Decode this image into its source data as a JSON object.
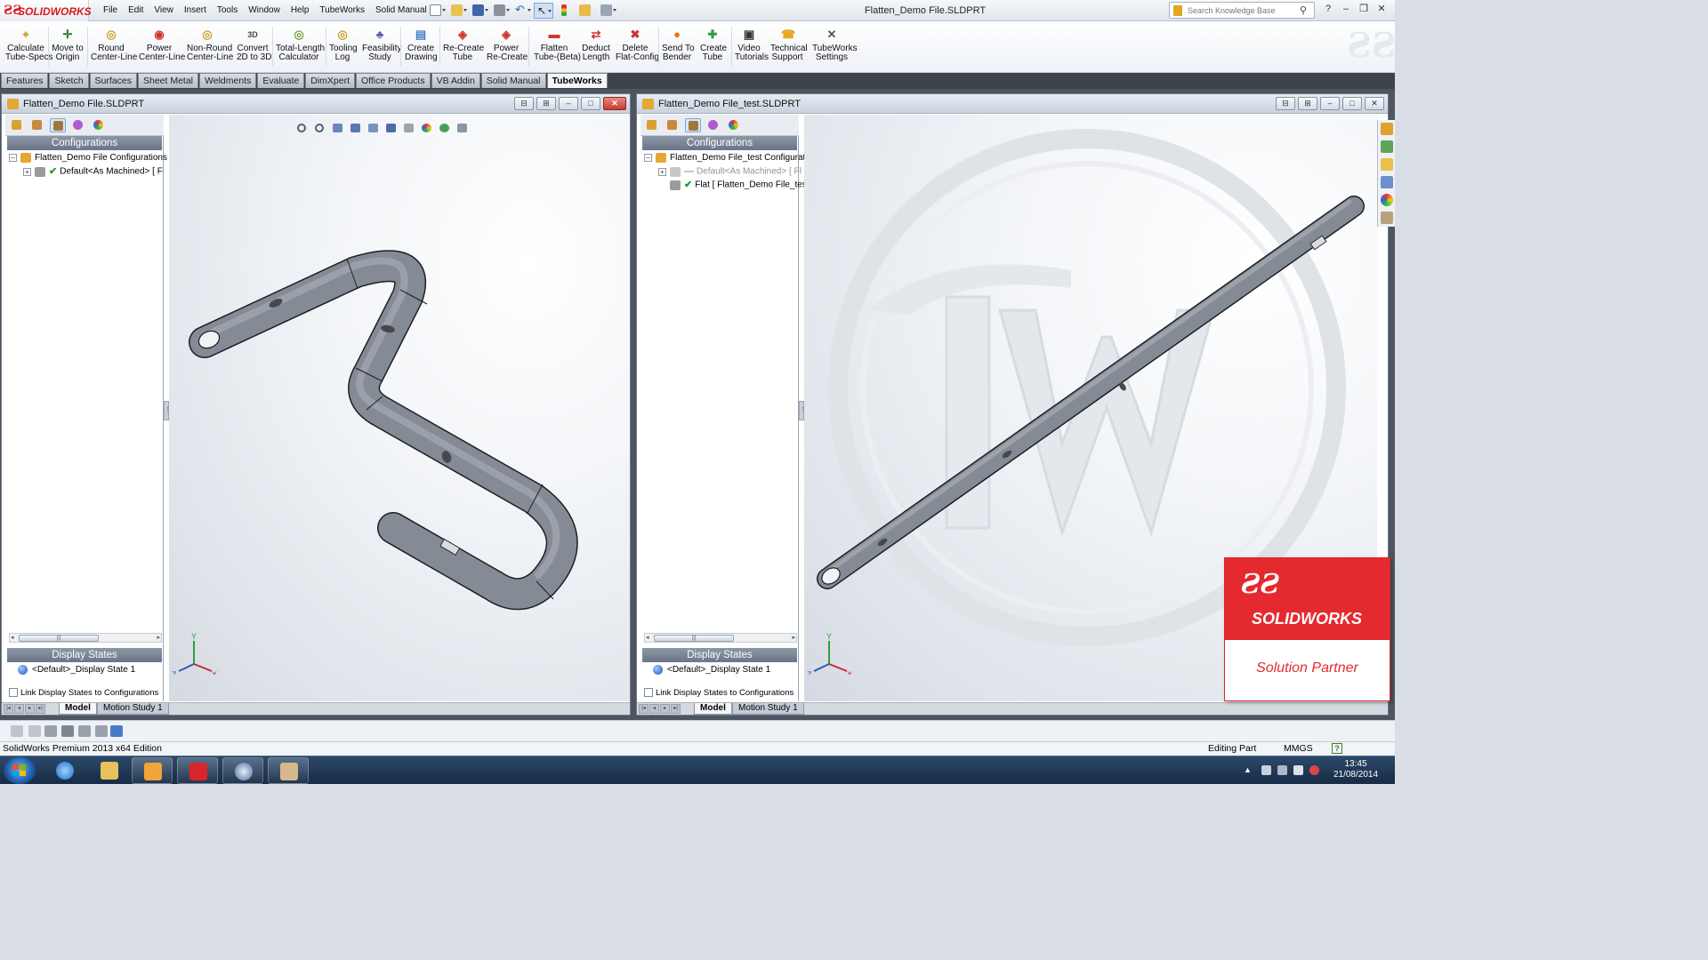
{
  "app": {
    "logo_text": "SOLIDWORKS",
    "document_title": "Flatten_Demo File.SLDPRT"
  },
  "menu": [
    "File",
    "Edit",
    "View",
    "Insert",
    "Tools",
    "Window",
    "Help",
    "TubeWorks",
    "Solid Manual"
  ],
  "search": {
    "placeholder": "Search Knowledge Base"
  },
  "commands": [
    {
      "line1": "Calculate",
      "line2": "Tube-Specs",
      "icon": "calculate-icon",
      "color": "#c9a227"
    },
    {
      "line1": "Move to",
      "line2": "Origin",
      "icon": "axes-icon",
      "color": "#2b7a2b"
    },
    {
      "line1": "Round",
      "line2": "Center-Line",
      "icon": "round-centerline-icon",
      "color": "#c9a227"
    },
    {
      "line1": "Power",
      "line2": "Center-Line",
      "icon": "power-centerline-icon",
      "color": "#d0342c"
    },
    {
      "line1": "Non-Round",
      "line2": "Center-Line",
      "icon": "nonround-centerline-icon",
      "color": "#c9a227"
    },
    {
      "line1": "Convert",
      "line2": "2D to 3D",
      "icon": "3d-convert-icon",
      "color": "#444444"
    },
    {
      "line1": "Total-Length",
      "line2": "Calculator",
      "icon": "length-calculator-icon",
      "color": "#7aa33b"
    },
    {
      "line1": "Tooling",
      "line2": "Log",
      "icon": "tooling-log-icon",
      "color": "#c9a227"
    },
    {
      "line1": "Feasibility",
      "line2": "Study",
      "icon": "feasibility-icon",
      "color": "#5b5bb0"
    },
    {
      "line1": "Create",
      "line2": "Drawing",
      "icon": "drawing-icon",
      "color": "#4a7fc1"
    },
    {
      "line1": "Re-Create",
      "line2": "Tube",
      "icon": "recreate-tube-icon",
      "color": "#d0342c"
    },
    {
      "line1": "Power",
      "line2": "Re-Create",
      "icon": "power-recreate-icon",
      "color": "#d0342c"
    },
    {
      "line1": "Flatten",
      "line2": "Tube-(Beta)",
      "icon": "flatten-icon",
      "color": "#d0342c"
    },
    {
      "line1": "Deduct",
      "line2": "Length",
      "icon": "deduct-length-icon",
      "color": "#d0342c"
    },
    {
      "line1": "Delete",
      "line2": "Flat-Config",
      "icon": "delete-config-icon",
      "color": "#d0342c"
    },
    {
      "line1": "Send To",
      "line2": "Bender",
      "icon": "send-bender-icon",
      "color": "#e5731d"
    },
    {
      "line1": "Create",
      "line2": "Tube",
      "icon": "create-tube-icon",
      "color": "#2f9a3b"
    },
    {
      "line1": "Video",
      "line2": "Tutorials",
      "icon": "video-icon",
      "color": "#333333"
    },
    {
      "line1": "Technical",
      "line2": "Support",
      "icon": "support-icon",
      "color": "#e5a71d"
    },
    {
      "line1": "TubeWorks",
      "line2": "Settings",
      "icon": "settings-icon",
      "color": "#555555"
    }
  ],
  "tabs": [
    "Features",
    "Sketch",
    "Surfaces",
    "Sheet Metal",
    "Weldments",
    "Evaluate",
    "DimXpert",
    "Office Products",
    "VB Addin",
    "Solid Manual",
    "TubeWorks"
  ],
  "active_tab": "TubeWorks",
  "windows": [
    {
      "title": "Flatten_Demo File.SLDPRT",
      "configurations_header": "Configurations",
      "tree_root": "Flatten_Demo File Configurations",
      "tree_items": [
        {
          "label": "Default<As Machined> [ F",
          "checked": true,
          "dim": false
        }
      ],
      "display_states_header": "Display States",
      "display_state": "<Default>_Display State 1",
      "link_label": "Link Display States to Configurations",
      "bottom_tabs": [
        "Model",
        "Motion Study 1"
      ]
    },
    {
      "title": "Flatten_Demo File_test.SLDPRT",
      "configurations_header": "Configurations",
      "tree_root": "Flatten_Demo File_test Configurat",
      "tree_items": [
        {
          "label": "Default<As Machined> [ Fl",
          "checked": false,
          "dim": true
        },
        {
          "label": "Flat [ Flatten_Demo File_tes",
          "checked": true,
          "dim": false
        }
      ],
      "display_states_header": "Display States",
      "display_state": "<Default>_Display State 1",
      "link_label": "Link Display States to Configurations",
      "bottom_tabs": [
        "Model",
        "Motion Study 1"
      ]
    }
  ],
  "triad": {
    "x": "X",
    "y": "Y",
    "z": "Z"
  },
  "partner": {
    "brand": "SOLIDWORKS",
    "subtitle": "Solution Partner"
  },
  "status": {
    "product": "SolidWorks Premium 2013 x64 Edition",
    "mode": "Editing Part",
    "units": "MMGS"
  },
  "taskbar": {
    "time": "13:45",
    "date": "21/08/2014"
  },
  "colors": {
    "brand_red": "#d71920",
    "tube_fill": "#8a909a",
    "viewport_bg": "#eef1f5",
    "fm_header": "#6f7b8c"
  }
}
